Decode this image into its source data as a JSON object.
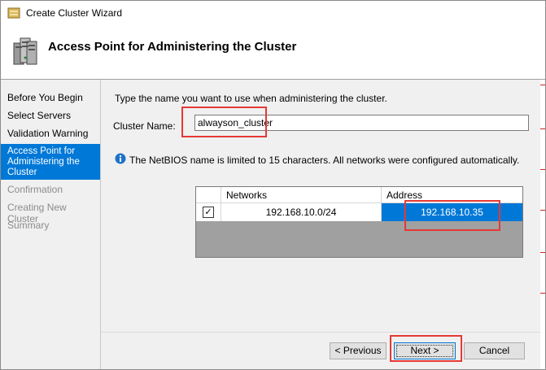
{
  "window": {
    "title": "Create Cluster Wizard"
  },
  "header": {
    "title": "Access Point for Administering the Cluster"
  },
  "steps": [
    {
      "label": "Before You Begin",
      "state": "done"
    },
    {
      "label": "Select Servers",
      "state": "done"
    },
    {
      "label": "Validation Warning",
      "state": "done"
    },
    {
      "label": "Access Point for Administering the Cluster",
      "state": "active"
    },
    {
      "label": "Confirmation",
      "state": "disabled"
    },
    {
      "label": "Creating New Cluster",
      "state": "disabled"
    },
    {
      "label": "Summary",
      "state": "disabled"
    }
  ],
  "main": {
    "prompt": "Type the name you want to use when administering the cluster.",
    "cluster_name_label": "Cluster Name:",
    "cluster_name_value": "alwayson_cluster",
    "info_text": "The NetBIOS name is limited to 15 characters.  All networks were configured automatically.",
    "networks": {
      "columns": [
        "Networks",
        "Address"
      ],
      "rows": [
        {
          "checked": true,
          "network": "192.168.10.0/24",
          "address": "192.168.10.35"
        }
      ]
    }
  },
  "buttons": {
    "previous": "< Previous",
    "next": "Next >",
    "cancel": "Cancel"
  },
  "colors": {
    "accent": "#0078d7",
    "highlight_box": "#e53935"
  }
}
